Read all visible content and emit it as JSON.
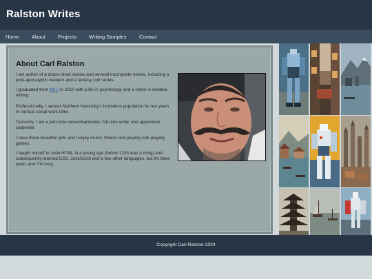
{
  "site": {
    "title": "Ralston Writes"
  },
  "nav": {
    "items": [
      "Home",
      "About",
      "Projects",
      "Writing Samples",
      "Contact"
    ]
  },
  "about": {
    "heading": "About Carl Ralston",
    "p1": "I am author of a dozen short stories and several incomplete novels, including a post-apocalyptic western and a fantasy noir series.",
    "p2_before": "I graduated from ",
    "p2_link": "NKU",
    "p2_after": " in 2010 with a BA in psychology and a minor in creative writing.",
    "p3": "Professionally, I served Northern Kentucky's homeless population for ten years in various social work roles.",
    "p4": "Currently, I am a part-time server/bartender, full-time writer and apprentice carpenter.",
    "p5": "I have three beautiful girls and I enjoy music, fitness and playing role-playing games.",
    "p6": "I taught myself to code HTML at a young age (before CSS was a thing) and subsequently learned CSS, JavaScript and a few other languages, but it's been years and I'm rusty."
  },
  "footer": {
    "text": "Copyright Carl Ralston 2024"
  },
  "colors": {
    "header": "#283544",
    "nav": "#3a4c5e",
    "content_bg": "#9aa9a7",
    "page_bg": "#d2d9da",
    "link": "#2d56a0"
  }
}
